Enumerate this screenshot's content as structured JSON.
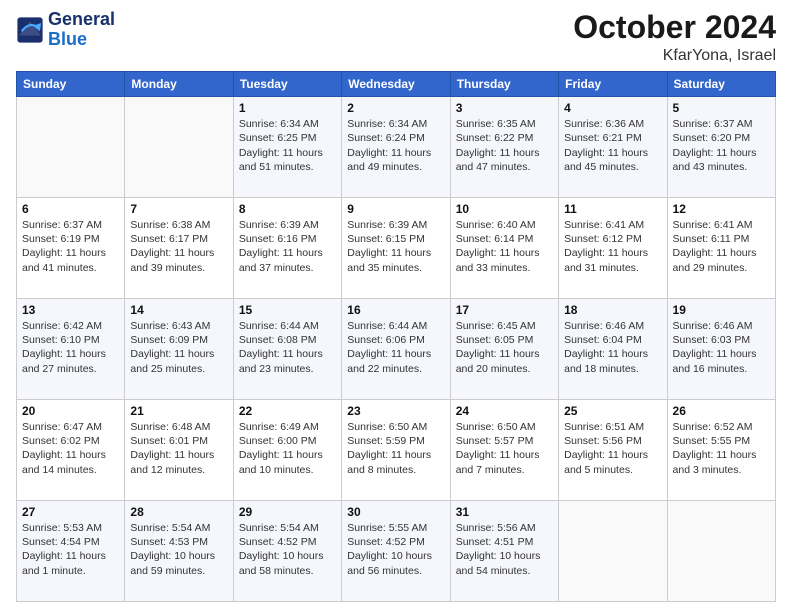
{
  "header": {
    "logo_line1": "General",
    "logo_line2": "Blue",
    "month": "October 2024",
    "location": "KfarYona, Israel"
  },
  "weekdays": [
    "Sunday",
    "Monday",
    "Tuesday",
    "Wednesday",
    "Thursday",
    "Friday",
    "Saturday"
  ],
  "weeks": [
    [
      {
        "day": "",
        "info": ""
      },
      {
        "day": "",
        "info": ""
      },
      {
        "day": "1",
        "info": "Sunrise: 6:34 AM\nSunset: 6:25 PM\nDaylight: 11 hours and 51 minutes."
      },
      {
        "day": "2",
        "info": "Sunrise: 6:34 AM\nSunset: 6:24 PM\nDaylight: 11 hours and 49 minutes."
      },
      {
        "day": "3",
        "info": "Sunrise: 6:35 AM\nSunset: 6:22 PM\nDaylight: 11 hours and 47 minutes."
      },
      {
        "day": "4",
        "info": "Sunrise: 6:36 AM\nSunset: 6:21 PM\nDaylight: 11 hours and 45 minutes."
      },
      {
        "day": "5",
        "info": "Sunrise: 6:37 AM\nSunset: 6:20 PM\nDaylight: 11 hours and 43 minutes."
      }
    ],
    [
      {
        "day": "6",
        "info": "Sunrise: 6:37 AM\nSunset: 6:19 PM\nDaylight: 11 hours and 41 minutes."
      },
      {
        "day": "7",
        "info": "Sunrise: 6:38 AM\nSunset: 6:17 PM\nDaylight: 11 hours and 39 minutes."
      },
      {
        "day": "8",
        "info": "Sunrise: 6:39 AM\nSunset: 6:16 PM\nDaylight: 11 hours and 37 minutes."
      },
      {
        "day": "9",
        "info": "Sunrise: 6:39 AM\nSunset: 6:15 PM\nDaylight: 11 hours and 35 minutes."
      },
      {
        "day": "10",
        "info": "Sunrise: 6:40 AM\nSunset: 6:14 PM\nDaylight: 11 hours and 33 minutes."
      },
      {
        "day": "11",
        "info": "Sunrise: 6:41 AM\nSunset: 6:12 PM\nDaylight: 11 hours and 31 minutes."
      },
      {
        "day": "12",
        "info": "Sunrise: 6:41 AM\nSunset: 6:11 PM\nDaylight: 11 hours and 29 minutes."
      }
    ],
    [
      {
        "day": "13",
        "info": "Sunrise: 6:42 AM\nSunset: 6:10 PM\nDaylight: 11 hours and 27 minutes."
      },
      {
        "day": "14",
        "info": "Sunrise: 6:43 AM\nSunset: 6:09 PM\nDaylight: 11 hours and 25 minutes."
      },
      {
        "day": "15",
        "info": "Sunrise: 6:44 AM\nSunset: 6:08 PM\nDaylight: 11 hours and 23 minutes."
      },
      {
        "day": "16",
        "info": "Sunrise: 6:44 AM\nSunset: 6:06 PM\nDaylight: 11 hours and 22 minutes."
      },
      {
        "day": "17",
        "info": "Sunrise: 6:45 AM\nSunset: 6:05 PM\nDaylight: 11 hours and 20 minutes."
      },
      {
        "day": "18",
        "info": "Sunrise: 6:46 AM\nSunset: 6:04 PM\nDaylight: 11 hours and 18 minutes."
      },
      {
        "day": "19",
        "info": "Sunrise: 6:46 AM\nSunset: 6:03 PM\nDaylight: 11 hours and 16 minutes."
      }
    ],
    [
      {
        "day": "20",
        "info": "Sunrise: 6:47 AM\nSunset: 6:02 PM\nDaylight: 11 hours and 14 minutes."
      },
      {
        "day": "21",
        "info": "Sunrise: 6:48 AM\nSunset: 6:01 PM\nDaylight: 11 hours and 12 minutes."
      },
      {
        "day": "22",
        "info": "Sunrise: 6:49 AM\nSunset: 6:00 PM\nDaylight: 11 hours and 10 minutes."
      },
      {
        "day": "23",
        "info": "Sunrise: 6:50 AM\nSunset: 5:59 PM\nDaylight: 11 hours and 8 minutes."
      },
      {
        "day": "24",
        "info": "Sunrise: 6:50 AM\nSunset: 5:57 PM\nDaylight: 11 hours and 7 minutes."
      },
      {
        "day": "25",
        "info": "Sunrise: 6:51 AM\nSunset: 5:56 PM\nDaylight: 11 hours and 5 minutes."
      },
      {
        "day": "26",
        "info": "Sunrise: 6:52 AM\nSunset: 5:55 PM\nDaylight: 11 hours and 3 minutes."
      }
    ],
    [
      {
        "day": "27",
        "info": "Sunrise: 5:53 AM\nSunset: 4:54 PM\nDaylight: 11 hours and 1 minute."
      },
      {
        "day": "28",
        "info": "Sunrise: 5:54 AM\nSunset: 4:53 PM\nDaylight: 10 hours and 59 minutes."
      },
      {
        "day": "29",
        "info": "Sunrise: 5:54 AM\nSunset: 4:52 PM\nDaylight: 10 hours and 58 minutes."
      },
      {
        "day": "30",
        "info": "Sunrise: 5:55 AM\nSunset: 4:52 PM\nDaylight: 10 hours and 56 minutes."
      },
      {
        "day": "31",
        "info": "Sunrise: 5:56 AM\nSunset: 4:51 PM\nDaylight: 10 hours and 54 minutes."
      },
      {
        "day": "",
        "info": ""
      },
      {
        "day": "",
        "info": ""
      }
    ]
  ]
}
